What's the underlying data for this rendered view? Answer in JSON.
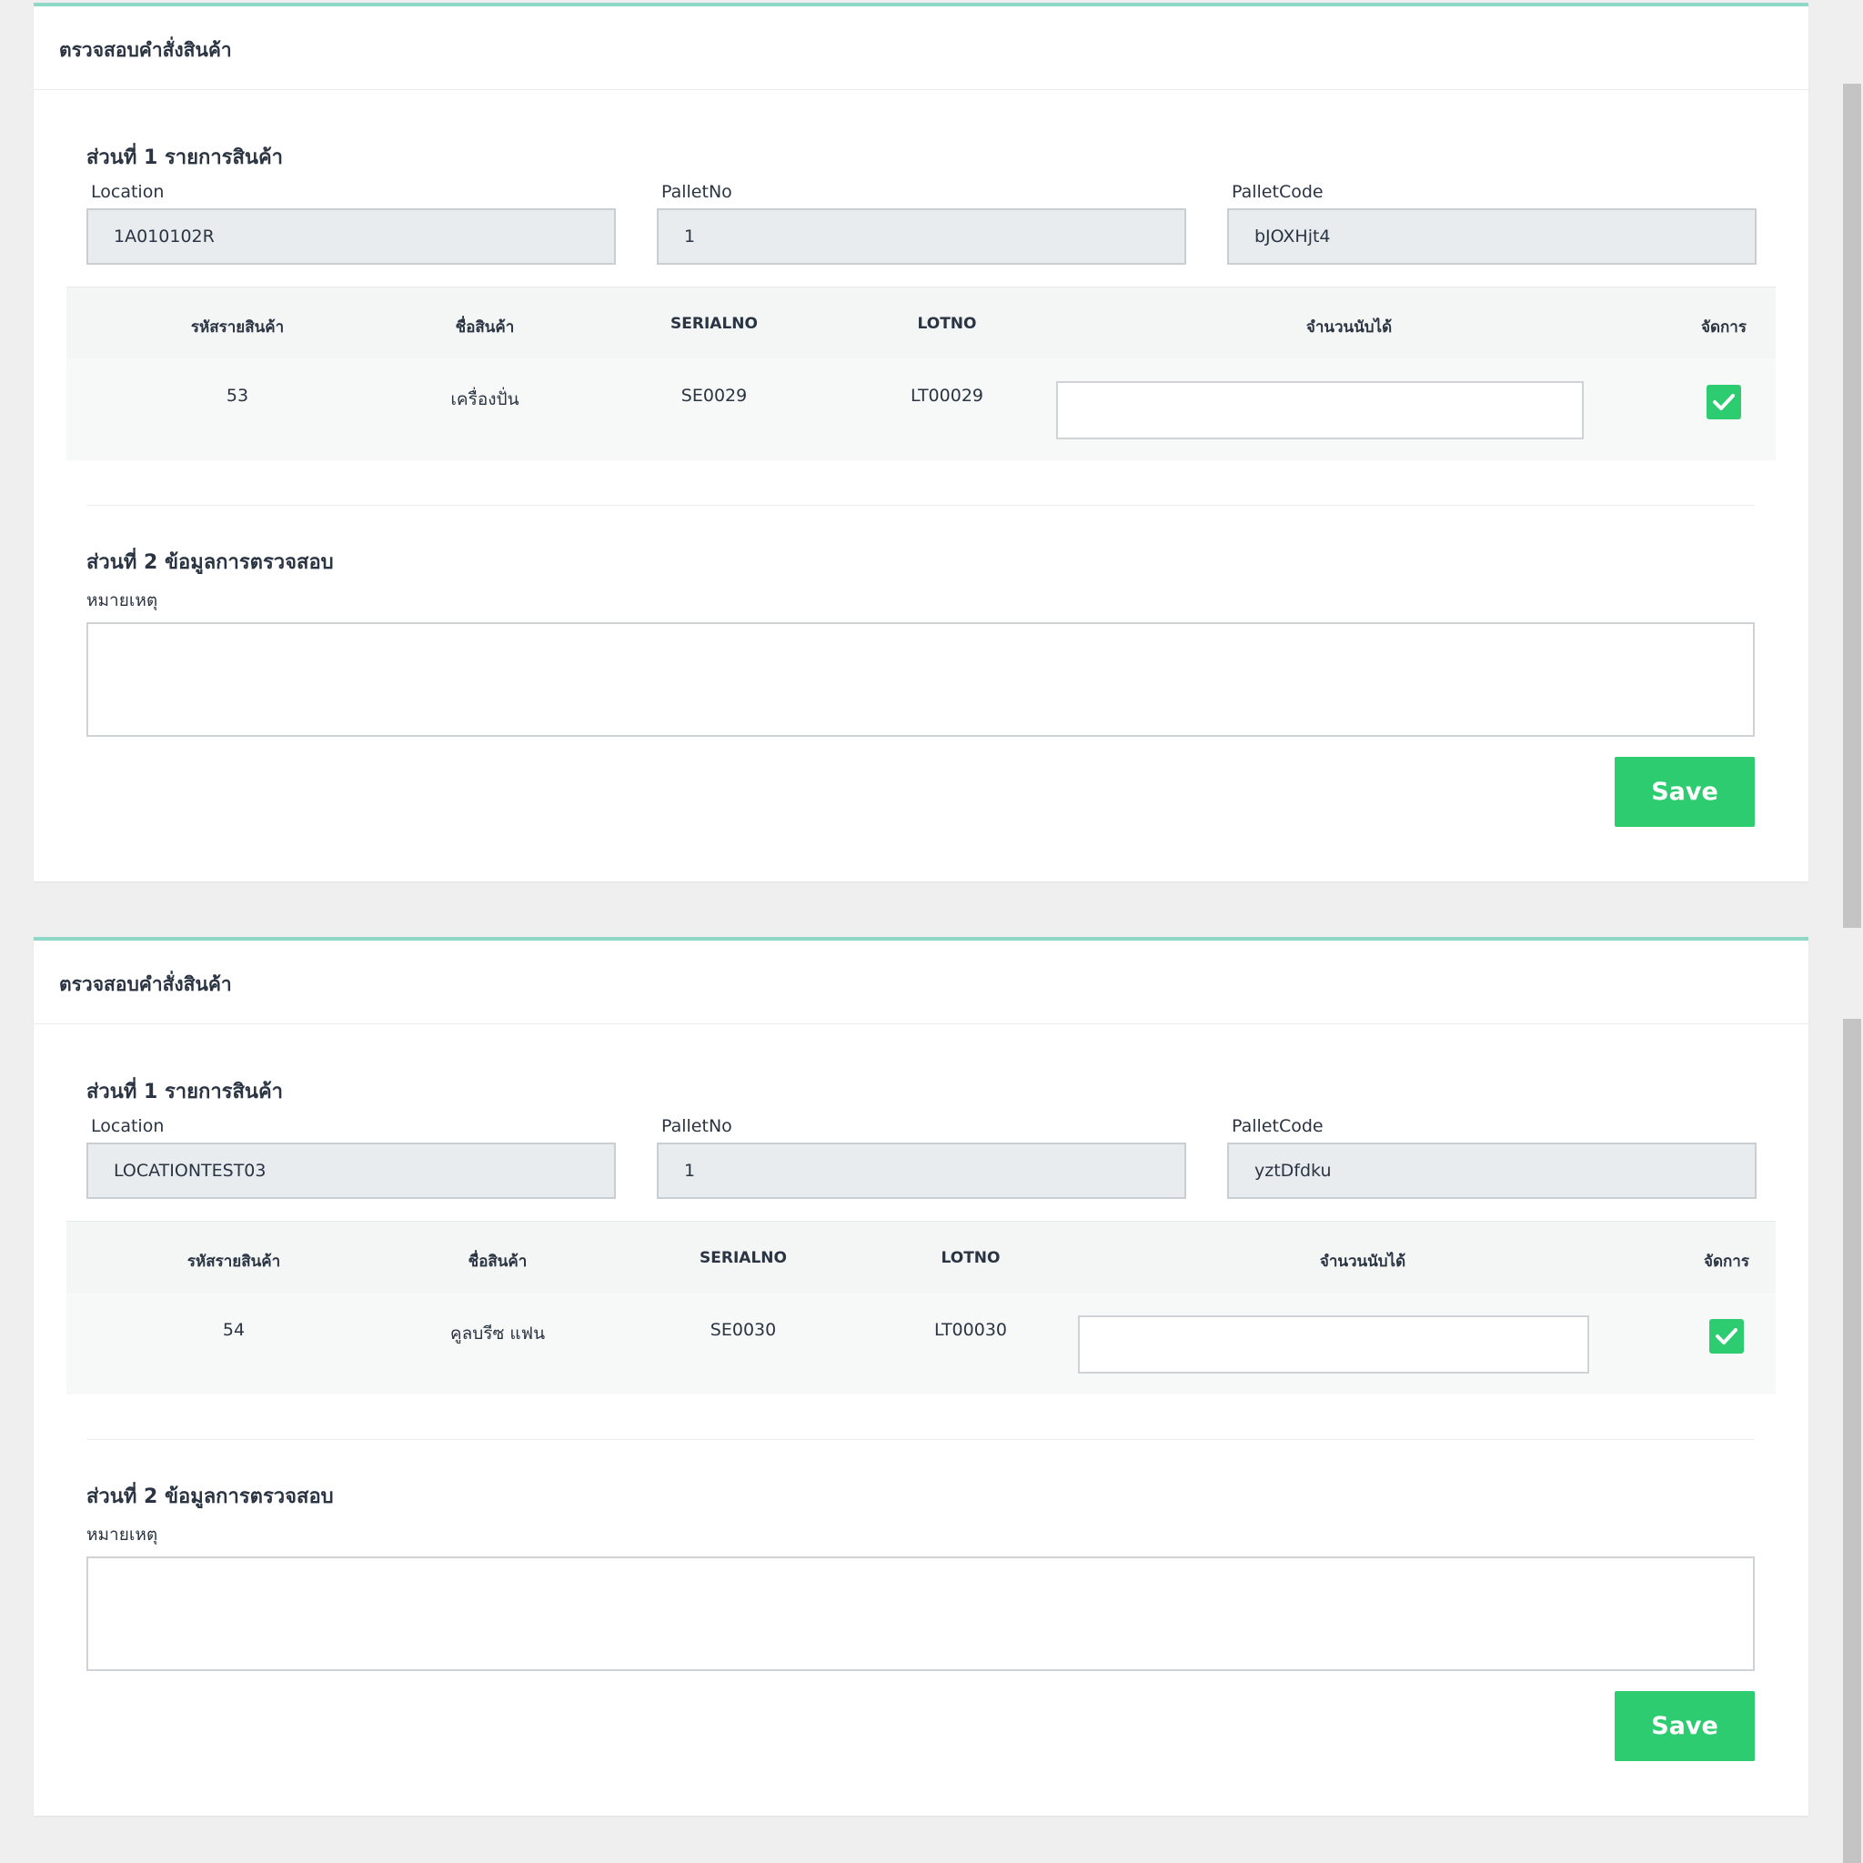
{
  "forms": [
    {
      "panel_title": "ตรวจสอบคำสั่งสินค้า",
      "section1_title": "ส่วนที่ 1 รายการสินค้า",
      "fields": {
        "location": {
          "label": "Location",
          "value": "1A010102R"
        },
        "pallet_no": {
          "label": "PalletNo",
          "value": "1"
        },
        "pallet_code": {
          "label": "PalletCode",
          "value": "bJOXHjt4"
        }
      },
      "table": {
        "headers": [
          "รหัสรายสินค้า",
          "ชื่อสินค้า",
          "SERIALNO",
          "LOTNO",
          "จำนวนนับได้",
          "จัดการ"
        ],
        "row": {
          "code": "53",
          "name": "เครื่องปั่น",
          "serial": "SE0029",
          "lot": "LT00029",
          "counted": "",
          "checked": true
        }
      },
      "section2_title": "ส่วนที่ 2 ข้อมูลการตรวจสอบ",
      "remark_label": "หมายเหตุ",
      "remark_value": "",
      "save_label": "Save"
    },
    {
      "panel_title": "ตรวจสอบคำสั่งสินค้า",
      "section1_title": "ส่วนที่ 1 รายการสินค้า",
      "fields": {
        "location": {
          "label": "Location",
          "value": "LOCATIONTEST03"
        },
        "pallet_no": {
          "label": "PalletNo",
          "value": "1"
        },
        "pallet_code": {
          "label": "PalletCode",
          "value": "yztDfdku"
        }
      },
      "table": {
        "headers": [
          "รหัสรายสินค้า",
          "ชื่อสินค้า",
          "SERIALNO",
          "LOTNO",
          "จำนวนนับได้",
          "จัดการ"
        ],
        "row": {
          "code": "54",
          "name": "คูลบรีซ แฟน",
          "serial": "SE0030",
          "lot": "LT00030",
          "counted": "",
          "checked": true
        }
      },
      "section2_title": "ส่วนที่ 2 ข้อมูลการตรวจสอบ",
      "remark_label": "หมายเหตุ",
      "remark_value": "",
      "save_label": "Save"
    }
  ],
  "colors": {
    "accent": "#8ed8c8",
    "success": "#2ecc71",
    "field_bg": "#e9ecef"
  }
}
